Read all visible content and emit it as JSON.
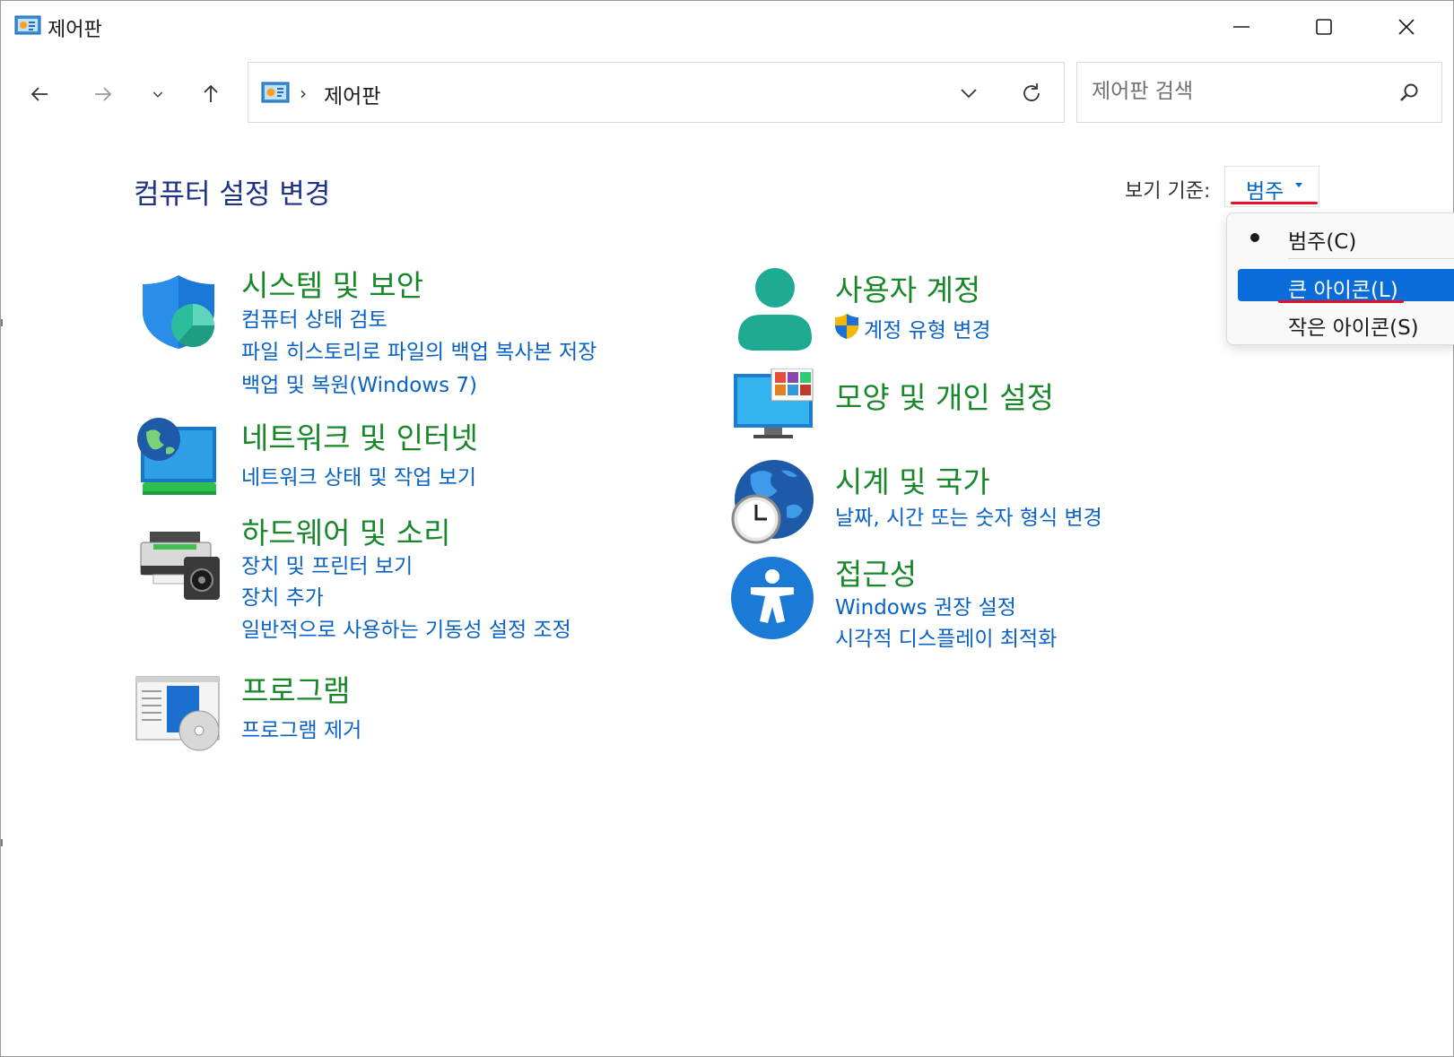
{
  "window": {
    "title": "제어판",
    "icon": "control-panel-icon",
    "buttons": [
      "minimize-icon",
      "maximize-icon",
      "close-icon"
    ]
  },
  "nav": {
    "back_icon": "back-arrow-icon",
    "forward_icon": "forward-arrow-icon",
    "recent_icon": "chevron-down-icon",
    "up_icon": "up-arrow-icon"
  },
  "address": {
    "crumb_separator": "›",
    "location": "제어판"
  },
  "search": {
    "placeholder": "제어판 검색"
  },
  "content": {
    "heading": "컴퓨터 설정 변경",
    "view_by_label": "보기 기준:",
    "view_by_value": "범주"
  },
  "view_menu": {
    "items": [
      {
        "label": "범주(C)",
        "checked": true,
        "highlighted": false
      },
      {
        "label": "큰 아이콘(L)",
        "checked": false,
        "highlighted": true
      },
      {
        "label": "작은 아이콘(S)",
        "checked": false,
        "highlighted": false
      }
    ]
  },
  "categories": {
    "left": [
      {
        "title": "시스템 및 보안",
        "icon": "shield-icon",
        "links": [
          "컴퓨터 상태 검토",
          "파일 히스토리로 파일의 백업 복사본 저장",
          "백업 및 복원(Windows 7)"
        ]
      },
      {
        "title": "네트워크 및 인터넷",
        "icon": "network-globe-icon",
        "links": [
          "네트워크 상태 및 작업 보기"
        ]
      },
      {
        "title": "하드웨어 및 소리",
        "icon": "printer-speaker-icon",
        "links": [
          "장치 및 프린터 보기",
          "장치 추가",
          "일반적으로 사용하는 기동성 설정 조정"
        ]
      },
      {
        "title": "프로그램",
        "icon": "programs-disc-icon",
        "links": [
          "프로그램 제거"
        ]
      }
    ],
    "right": [
      {
        "title": "사용자 계정",
        "icon": "user-account-icon",
        "links": [
          "계정 유형 변경"
        ]
      },
      {
        "title": "모양 및 개인 설정",
        "icon": "monitor-personalize-icon",
        "links": []
      },
      {
        "title": "시계 및 국가",
        "icon": "globe-clock-icon",
        "links": [
          "날짜, 시간 또는 숫자 형식 변경"
        ]
      },
      {
        "title": "접근성",
        "icon": "accessibility-icon",
        "links": [
          "Windows 권장 설정",
          "시각적 디스플레이 최적화"
        ]
      }
    ]
  },
  "colors": {
    "category_title": "#18872a",
    "link": "#0a63c4",
    "heading": "#1e3287",
    "menu_highlight": "#0a6cd8",
    "annotation_underline": "#e81123"
  }
}
